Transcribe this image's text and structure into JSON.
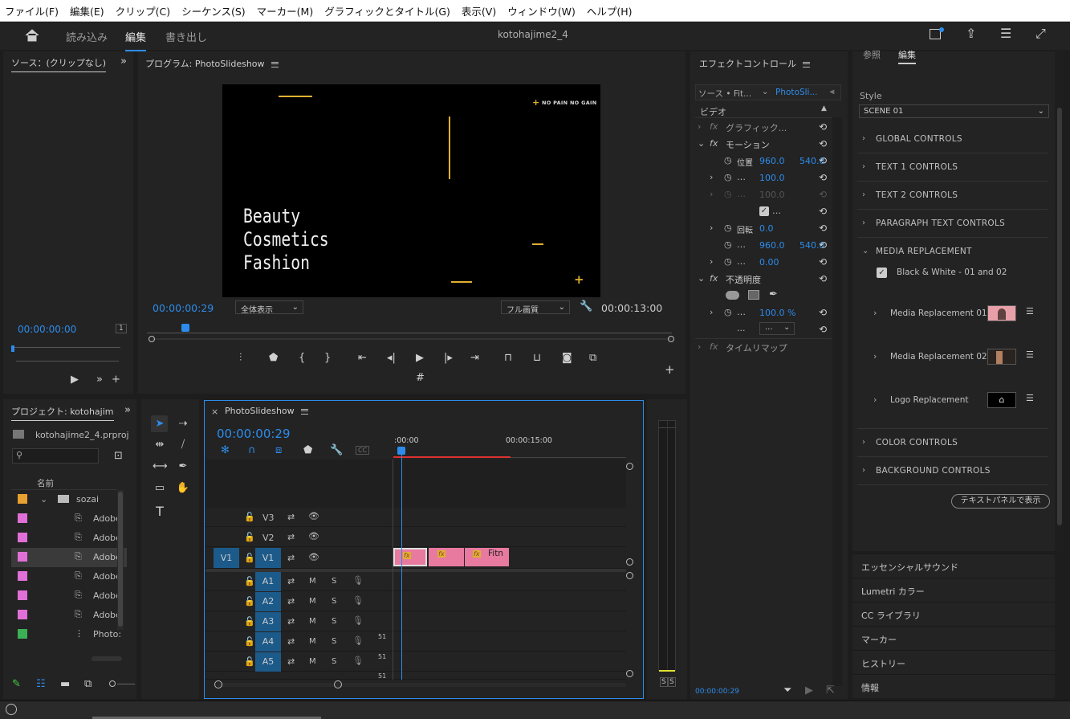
{
  "menu": [
    "ファイル(F)",
    "編集(E)",
    "クリップ(C)",
    "シーケンス(S)",
    "マーカー(M)",
    "グラフィックとタイトル(G)",
    "表示(V)",
    "ウィンドウ(W)",
    "ヘルプ(H)"
  ],
  "workspaces": {
    "import": "読み込み",
    "edit": "編集",
    "export": "書き出し"
  },
  "project_title": "kotohajime2_4",
  "source": {
    "title": "ソース：(クリップなし)",
    "timecode": "00:00:00:00",
    "zoom": "1"
  },
  "program": {
    "title": "プログラム: PhotoSlideshow",
    "timecode": "00:00:00:29",
    "fit": "全体表示",
    "quality": "フル画質",
    "duration": "00:00:13:00",
    "video": {
      "line1": "Beauty",
      "line2": "Cosmetics",
      "line3": "Fashion",
      "tag": "NO PAIN NO GAIN",
      "tag_plus": "+",
      "plus": "+"
    }
  },
  "effect_controls": {
    "title": "エフェクトコントロール",
    "tab_source": "ソース • Fit...",
    "tab_seq": "PhotoSli...",
    "section_video": "ビデオ",
    "graphic": "グラフィック...",
    "motion": "モーション",
    "position_label": "位置",
    "pos_x": "960.0",
    "pos_y": "540.0",
    "scale": "100.0",
    "scale2": "100.0",
    "rotation_label": "回転",
    "rotation": "0.0",
    "anchor_x": "960.0",
    "anchor_y": "540.0",
    "flicker": "0.00",
    "opacity_section": "不透明度",
    "opacity": "100.0 %",
    "blend": "...",
    "dots": "...",
    "timeremap": "タイムリマップ",
    "timecode": "00:00:00:29"
  },
  "essential_graphics": {
    "tab_browse": "参照",
    "tab_edit": "編集",
    "style_label": "Style",
    "style_value": "SCENE 01",
    "sections": [
      "GLOBAL CONTROLS",
      "TEXT 1 CONTROLS",
      "TEXT 2 CONTROLS",
      "PARAGRAPH TEXT CONTROLS"
    ],
    "media_replacement": "MEDIA REPLACEMENT",
    "bw_label": "Black & White - 01 and 02",
    "media_items": [
      "Media Replacement 01",
      "Media Replacement 02",
      "Logo Replacement"
    ],
    "sections2": [
      "COLOR CONTROLS",
      "BACKGROUND CONTROLS"
    ],
    "text_panel_btn": "テキストパネルで表示"
  },
  "right_panels": [
    "エッセンシャルサウンド",
    "Lumetri カラー",
    "CC ライブラリ",
    "マーカー",
    "ヒストリー",
    "情報"
  ],
  "project": {
    "title": "プロジェクト: kotohajim",
    "file": "kotohajime2_4.prproj",
    "col_name": "名前",
    "items": [
      {
        "name": "sozai",
        "color": "#e8a030"
      },
      {
        "name": "Adobe",
        "color": "#e070d8"
      },
      {
        "name": "Adobe",
        "color": "#e070d8"
      },
      {
        "name": "Adobe",
        "color": "#e070d8"
      },
      {
        "name": "Adobe",
        "color": "#e070d8"
      },
      {
        "name": "Adobe",
        "color": "#e070d8"
      },
      {
        "name": "Adobe",
        "color": "#e070d8"
      },
      {
        "name": "Photo:",
        "color": "#3cb054"
      }
    ]
  },
  "timeline": {
    "seq": "PhotoSlideshow",
    "close": "×",
    "timecode": "00:00:00:29",
    "ruler_start": ":00:00",
    "ruler_mid": "00:00:15:00",
    "video_tracks": [
      "V3",
      "V2",
      "V1"
    ],
    "audio_tracks": [
      "A1",
      "A2",
      "A3",
      "A4",
      "A5"
    ],
    "src_v": "V1",
    "clip_label": "Fitn",
    "m": "M",
    "s": "S",
    "level": "51"
  },
  "meter": {
    "s1": "S",
    "s2": "S"
  }
}
